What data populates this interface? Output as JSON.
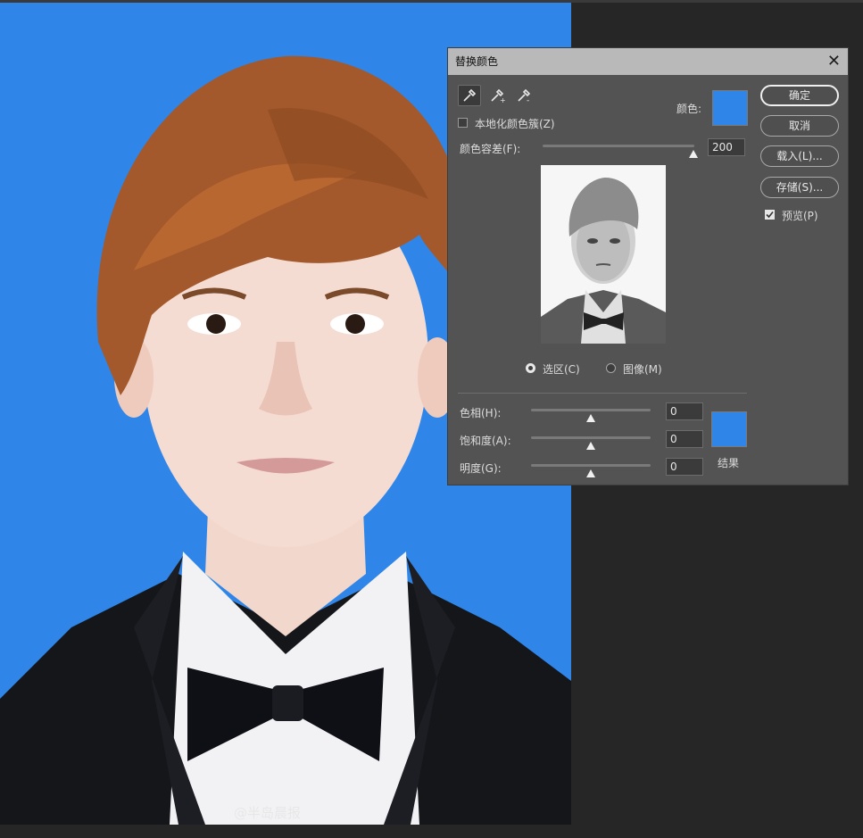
{
  "photo": {
    "background_color": "#2f86e8",
    "watermark": "@半岛晨报"
  },
  "dialog": {
    "title": "替换颜色",
    "eyedroppers": [
      "eyedropper-icon",
      "eyedropper-plus-icon",
      "eyedropper-minus-icon"
    ],
    "localized_label": "本地化颜色簇(Z)",
    "localized_checked": false,
    "color_label": "颜色:",
    "color_value": "#2f86e8",
    "tolerance_label": "颜色容差(F):",
    "tolerance_value": "200",
    "tolerance_fraction": 1.0,
    "view_options": [
      {
        "label": "选区(C)",
        "selected": true
      },
      {
        "label": "图像(M)",
        "selected": false
      }
    ],
    "hue_label": "色相(H):",
    "hue_value": "0",
    "saturation_label": "饱和度(A):",
    "saturation_value": "0",
    "lightness_label": "明度(G):",
    "lightness_value": "0",
    "result_label": "结果",
    "result_color": "#2f86e8",
    "buttons": {
      "ok": "确定",
      "cancel": "取消",
      "load": "载入(L)...",
      "save": "存储(S)..."
    },
    "preview_label": "预览(P)",
    "preview_checked": true
  }
}
